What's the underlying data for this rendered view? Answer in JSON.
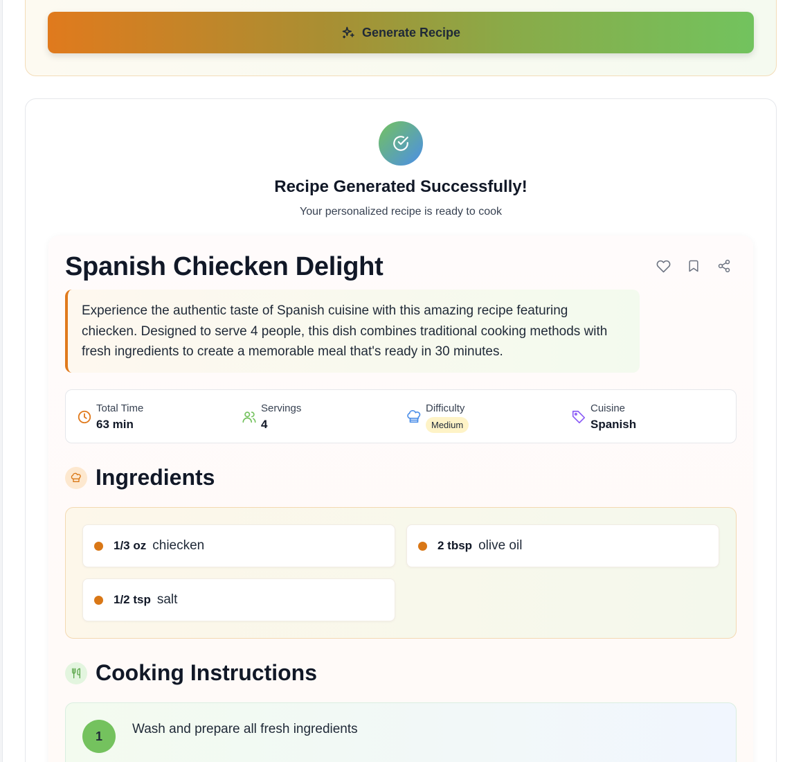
{
  "form": {
    "generate_label": "Generate Recipe"
  },
  "result": {
    "success_title": "Recipe Generated Successfully!",
    "success_subtitle": "Your personalized recipe is ready to cook"
  },
  "recipe": {
    "title": "Spanish Chiecken Delight",
    "description": "Experience the authentic taste of Spanish cuisine with this amazing recipe featuring chiecken. Designed to serve 4 people, this dish combines traditional cooking methods with fresh ingredients to create a memorable meal that's ready in 30 minutes.",
    "stats": {
      "total_time": {
        "label": "Total Time",
        "value": "63 min"
      },
      "servings": {
        "label": "Servings",
        "value": "4"
      },
      "difficulty": {
        "label": "Difficulty",
        "value": "Medium"
      },
      "cuisine": {
        "label": "Cuisine",
        "value": "Spanish"
      }
    },
    "ingredients_title": "Ingredients",
    "ingredients": [
      {
        "qty": "1/3 oz",
        "name": "chiecken"
      },
      {
        "qty": "2 tbsp",
        "name": "olive oil"
      },
      {
        "qty": "1/2 tsp",
        "name": "salt"
      }
    ],
    "instructions_title": "Cooking Instructions",
    "steps": [
      {
        "num": "1",
        "text": "Wash and prepare all fresh ingredients"
      }
    ]
  },
  "colors": {
    "accent_orange": "#e07a1d",
    "accent_green": "#74c25e",
    "accent_blue": "#4b8ee8",
    "accent_purple": "#8b5cf6"
  },
  "icons": {
    "generate": "sparkles-icon",
    "success": "check-circle-icon",
    "like": "heart-icon",
    "save": "bookmark-icon",
    "share": "share-icon",
    "time": "clock-icon",
    "servings": "users-icon",
    "difficulty": "chef-hat-icon",
    "cuisine": "tag-icon",
    "ingredients": "chef-hat-icon",
    "instructions": "utensils-icon"
  }
}
